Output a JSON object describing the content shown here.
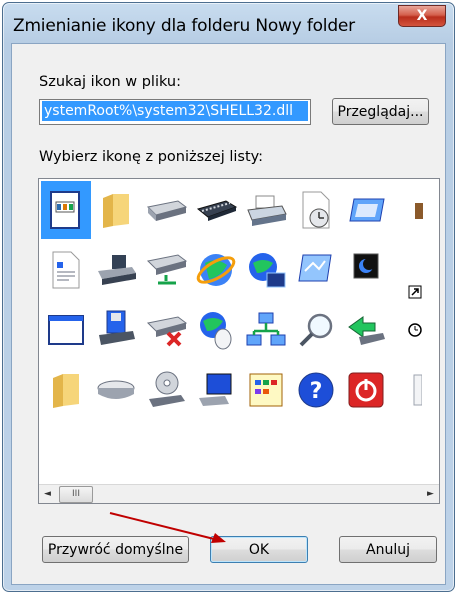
{
  "window": {
    "title": "Zmienianie ikony dla folderu Nowy folder",
    "close_label": "X"
  },
  "search": {
    "label": "Szukaj ikon w pliku:",
    "value": "ystemRoot%\\system32\\SHELL32.dll",
    "browse_label": "Przeglądaj..."
  },
  "icons": {
    "label": "Wybierz ikonę z poniższej listy:",
    "scroll_thumb_label": "III",
    "scroll_left": "◄",
    "scroll_right": "►"
  },
  "buttons": {
    "restore_label": "Przywróć domyślne",
    "ok_label": "OK",
    "cancel_label": "Anuluj"
  },
  "colors": {
    "selection": "#3399ff",
    "annotation_arrow": "#c00000"
  }
}
